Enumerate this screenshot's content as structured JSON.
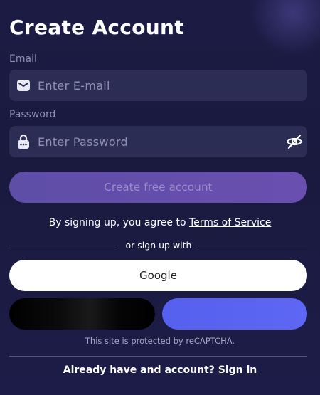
{
  "header": {
    "title": "Create Account"
  },
  "email": {
    "label": "Email",
    "placeholder": "Enter E-mail",
    "value": ""
  },
  "password": {
    "label": "Password",
    "placeholder": "Enter Password",
    "value": ""
  },
  "primary_button": {
    "label": "Create free account"
  },
  "terms": {
    "prefix": "By signing up, you agree to",
    "link": "Terms of Service"
  },
  "divider": {
    "text": "or sign up with"
  },
  "social": {
    "google_label": "Google"
  },
  "recaptcha": {
    "text": "This site is protected by reCAPTCHA."
  },
  "signin": {
    "prefix": "Already have and account?",
    "link": "Sign in"
  },
  "icons": {
    "email": "envelope-icon",
    "password": "lock-icon",
    "toggle": "eye-off-icon"
  },
  "colors": {
    "background": "#1c1b44",
    "input_bg": "#2b2d55",
    "primary": "#6a4fb0",
    "blue_button": "#5d67f3",
    "dark_button": "#000000",
    "google_button": "#ffffff"
  }
}
